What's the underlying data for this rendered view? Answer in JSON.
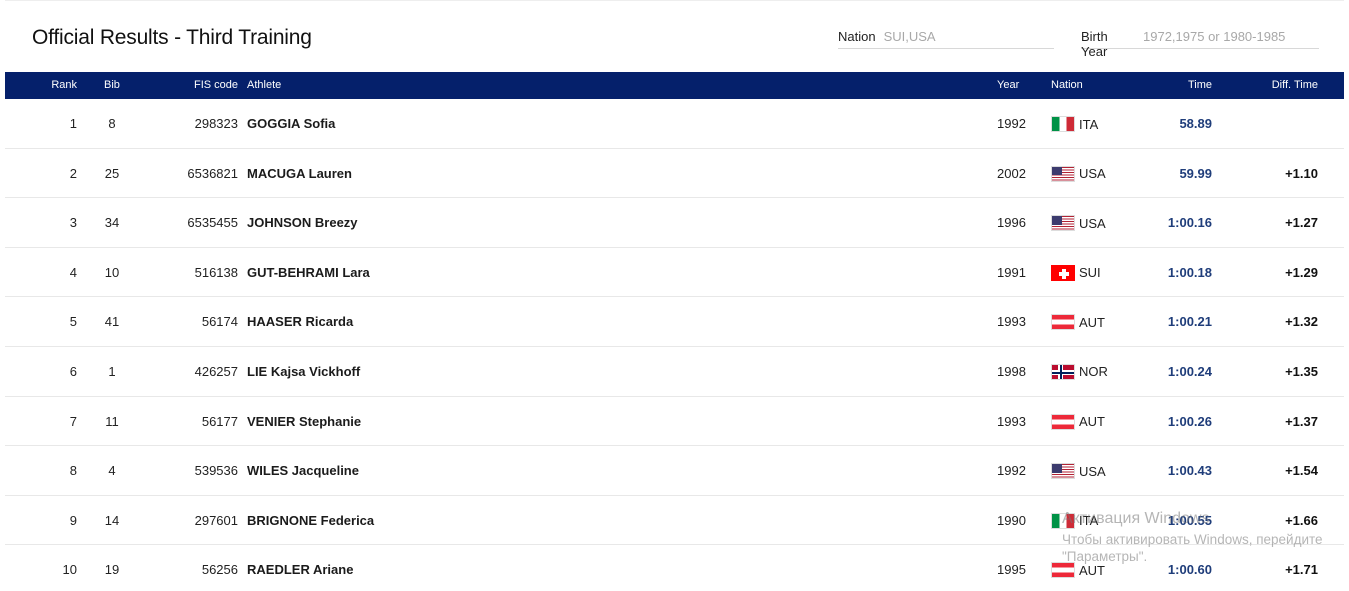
{
  "page": {
    "title": "Official Results - Third Training"
  },
  "filters": {
    "nation": {
      "label": "Nation",
      "placeholder": "SUI,USA"
    },
    "birth_year": {
      "label": "Birth Year",
      "placeholder": "1972,1975 or 1980-1985"
    }
  },
  "table": {
    "headers": {
      "rank": "Rank",
      "bib": "Bib",
      "fis_code": "FIS code",
      "athlete": "Athlete",
      "year": "Year",
      "nation": "Nation",
      "time": "Time",
      "diff_time": "Diff. Time"
    },
    "rows": [
      {
        "rank": "1",
        "bib": "8",
        "fis_code": "298323",
        "athlete": "GOGGIA Sofia",
        "year": "1992",
        "nation": "ITA",
        "flag_icon": "italy-flag-icon",
        "time": "58.89",
        "diff": ""
      },
      {
        "rank": "2",
        "bib": "25",
        "fis_code": "6536821",
        "athlete": "MACUGA Lauren",
        "year": "2002",
        "nation": "USA",
        "flag_icon": "usa-flag-icon",
        "time": "59.99",
        "diff": "+1.10"
      },
      {
        "rank": "3",
        "bib": "34",
        "fis_code": "6535455",
        "athlete": "JOHNSON Breezy",
        "year": "1996",
        "nation": "USA",
        "flag_icon": "usa-flag-icon",
        "time": "1:00.16",
        "diff": "+1.27"
      },
      {
        "rank": "4",
        "bib": "10",
        "fis_code": "516138",
        "athlete": "GUT-BEHRAMI Lara",
        "year": "1991",
        "nation": "SUI",
        "flag_icon": "switzerland-flag-icon",
        "time": "1:00.18",
        "diff": "+1.29"
      },
      {
        "rank": "5",
        "bib": "41",
        "fis_code": "56174",
        "athlete": "HAASER Ricarda",
        "year": "1993",
        "nation": "AUT",
        "flag_icon": "austria-flag-icon",
        "time": "1:00.21",
        "diff": "+1.32"
      },
      {
        "rank": "6",
        "bib": "1",
        "fis_code": "426257",
        "athlete": "LIE Kajsa Vickhoff",
        "year": "1998",
        "nation": "NOR",
        "flag_icon": "norway-flag-icon",
        "time": "1:00.24",
        "diff": "+1.35"
      },
      {
        "rank": "7",
        "bib": "11",
        "fis_code": "56177",
        "athlete": "VENIER Stephanie",
        "year": "1993",
        "nation": "AUT",
        "flag_icon": "austria-flag-icon",
        "time": "1:00.26",
        "diff": "+1.37"
      },
      {
        "rank": "8",
        "bib": "4",
        "fis_code": "539536",
        "athlete": "WILES Jacqueline",
        "year": "1992",
        "nation": "USA",
        "flag_icon": "usa-flag-icon",
        "time": "1:00.43",
        "diff": "+1.54"
      },
      {
        "rank": "9",
        "bib": "14",
        "fis_code": "297601",
        "athlete": "BRIGNONE Federica",
        "year": "1990",
        "nation": "ITA",
        "flag_icon": "italy-flag-icon",
        "time": "1:00.55",
        "diff": "+1.66"
      },
      {
        "rank": "10",
        "bib": "19",
        "fis_code": "56256",
        "athlete": "RAEDLER Ariane",
        "year": "1995",
        "nation": "AUT",
        "flag_icon": "austria-flag-icon",
        "time": "1:00.60",
        "diff": "+1.71"
      }
    ]
  },
  "os_watermark": {
    "line1": "Активация Windows",
    "line2": "Чтобы активировать Windows, перейдите",
    "line3": "\"Параметры\"."
  }
}
